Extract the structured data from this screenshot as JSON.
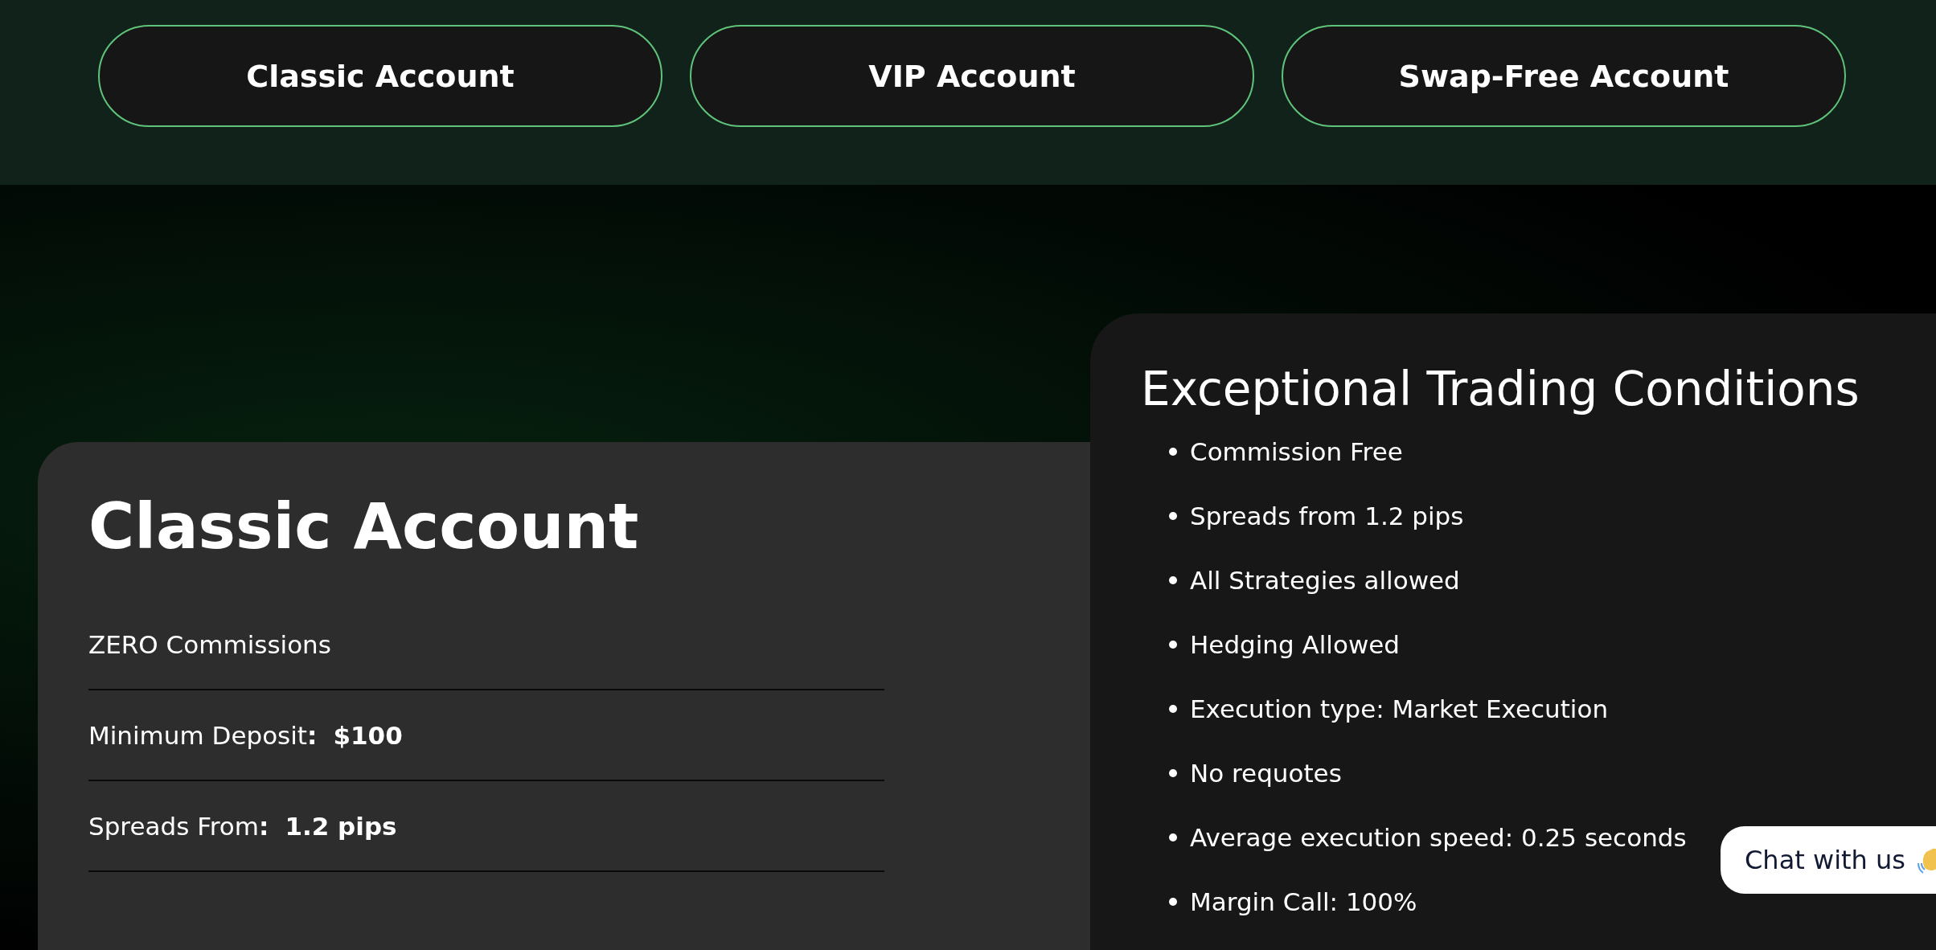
{
  "account_tabs": [
    {
      "label": "Classic Account"
    },
    {
      "label": "VIP Account"
    },
    {
      "label": "Swap-Free Account"
    }
  ],
  "account_card": {
    "title": "Classic Account",
    "rows": [
      {
        "label": "ZERO Commissions"
      },
      {
        "label": "Minimum Deposit**:**",
        "value": "$100"
      },
      {
        "label": "Spreads From**:**",
        "value": "1.2 pips"
      }
    ]
  },
  "conditions_card": {
    "title": "Exceptional Trading Conditions",
    "items": [
      "Commission Free",
      "Spreads from 1.2 pips",
      "All Strategies allowed",
      "Hedging Allowed",
      "Execution type: Market Execution",
      "No requotes",
      "Average execution speed: 0.25 seconds",
      "Margin Call: 100%"
    ]
  },
  "chat_widget": {
    "label": "Chat with us"
  }
}
